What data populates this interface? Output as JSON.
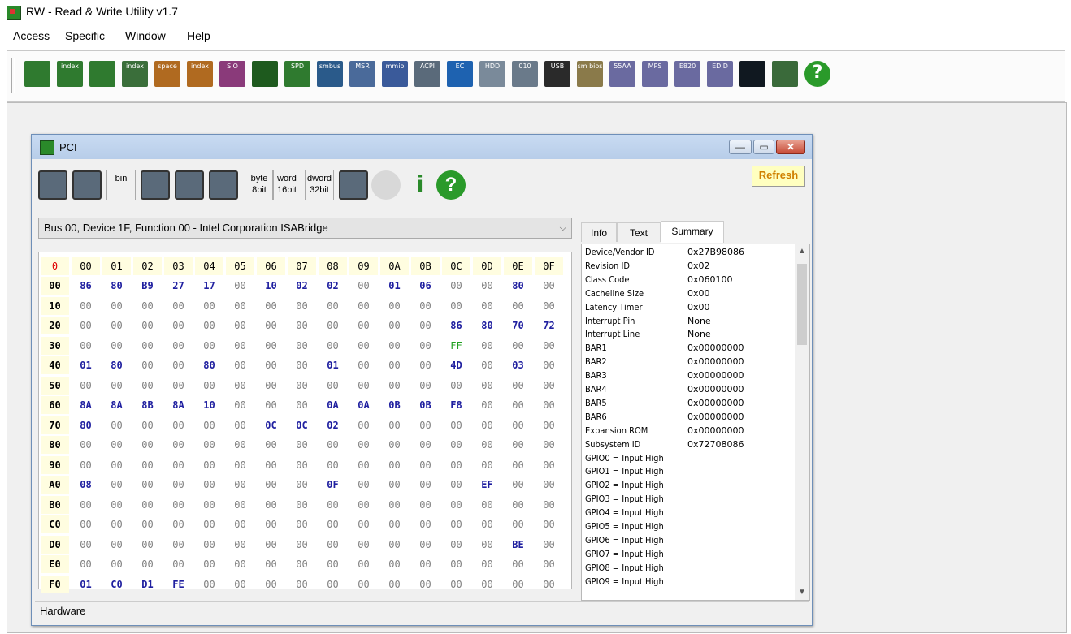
{
  "app": {
    "title": "RW - Read & Write Utility v1.7"
  },
  "menu": [
    "Access",
    "Specific",
    "Window",
    "Help"
  ],
  "toolbar": [
    {
      "name": "memory-icon",
      "label": "",
      "color": "#2f7a2f"
    },
    {
      "name": "memory-index-icon",
      "label": "index",
      "color": "#2f7a2f"
    },
    {
      "name": "ram-icon",
      "label": "",
      "color": "#2f7a2f"
    },
    {
      "name": "ram-index-icon",
      "label": "index",
      "color": "#3a6e3a"
    },
    {
      "name": "io-space-icon",
      "label": "space",
      "color": "#b06a20"
    },
    {
      "name": "io-index-icon",
      "label": "index",
      "color": "#b06a20"
    },
    {
      "name": "sio-icon",
      "label": "SIO",
      "color": "#8a3a7a"
    },
    {
      "name": "scope-icon",
      "label": "",
      "color": "#1e5a1e"
    },
    {
      "name": "spd-icon",
      "label": "SPD",
      "color": "#2f7a2f"
    },
    {
      "name": "smbus-icon",
      "label": "smbus",
      "color": "#2a5a8a"
    },
    {
      "name": "msr-icon",
      "label": "MSR",
      "color": "#4a6a9a"
    },
    {
      "name": "mmio-icon",
      "label": "mmio",
      "color": "#3a5a9a"
    },
    {
      "name": "acpi-icon",
      "label": "ACPI",
      "color": "#5a6a7a"
    },
    {
      "name": "ec-icon",
      "label": "EC",
      "color": "#1e62b0"
    },
    {
      "name": "hdd-icon",
      "label": "HDD",
      "color": "#7a8a9a"
    },
    {
      "name": "disk-icon",
      "label": "010",
      "color": "#6a7a8a"
    },
    {
      "name": "usb-icon",
      "label": "USB",
      "color": "#2a2a2a"
    },
    {
      "name": "smbios-icon",
      "label": "sm bios",
      "color": "#8a7a4a"
    },
    {
      "name": "55aa-icon",
      "label": "55AA",
      "color": "#6a6aa0"
    },
    {
      "name": "mps-icon",
      "label": "MPS",
      "color": "#6a6aa0"
    },
    {
      "name": "e820-icon",
      "label": "E820",
      "color": "#6a6aa0"
    },
    {
      "name": "edid-icon",
      "label": "EDID",
      "color": "#6a6aa0"
    },
    {
      "name": "command-icon",
      "label": "",
      "color": "#101820"
    },
    {
      "name": "battery-icon",
      "label": "",
      "color": "#3a6a3a"
    },
    {
      "name": "help-icon",
      "label": "?",
      "color": "#2a9a2a"
    }
  ],
  "pci": {
    "title": "PCI",
    "tools": [
      {
        "name": "save-icon",
        "label": ""
      },
      {
        "name": "save-all-icon",
        "label": ""
      },
      {
        "name": "save-bin-icon",
        "label": "bin"
      },
      {
        "name": "open-icon",
        "label": ""
      },
      {
        "name": "find-icon",
        "label": ""
      },
      {
        "name": "table-icon",
        "label": ""
      },
      {
        "name": "byte-8bit-icon",
        "label": "byte 8bit"
      },
      {
        "name": "word-16bit-icon",
        "label": "word 16bit"
      },
      {
        "name": "dword-32bit-icon",
        "label": "dword 32bit"
      },
      {
        "name": "tree-icon",
        "label": ""
      },
      {
        "name": "disabled-icon",
        "label": ""
      },
      {
        "name": "info-icon",
        "label": "i"
      },
      {
        "name": "help-icon",
        "label": "?"
      }
    ],
    "refresh_label": "Refresh",
    "device": "Bus 00, Device 1F, Function 00 - Intel Corporation ISABridge",
    "status": "Hardware",
    "tabs": [
      "Info",
      "Text",
      "Summary"
    ],
    "columns": [
      "0",
      "00",
      "01",
      "02",
      "03",
      "04",
      "05",
      "06",
      "07",
      "08",
      "09",
      "0A",
      "0B",
      "0C",
      "0D",
      "0E",
      "0F"
    ],
    "rows": [
      {
        "h": "00",
        "v": [
          "86",
          "80",
          "B9",
          "27",
          "17",
          "00",
          "10",
          "02",
          "02",
          "00",
          "01",
          "06",
          "00",
          "00",
          "80",
          "00"
        ]
      },
      {
        "h": "10",
        "v": [
          "00",
          "00",
          "00",
          "00",
          "00",
          "00",
          "00",
          "00",
          "00",
          "00",
          "00",
          "00",
          "00",
          "00",
          "00",
          "00"
        ]
      },
      {
        "h": "20",
        "v": [
          "00",
          "00",
          "00",
          "00",
          "00",
          "00",
          "00",
          "00",
          "00",
          "00",
          "00",
          "00",
          "86",
          "80",
          "70",
          "72"
        ]
      },
      {
        "h": "30",
        "v": [
          "00",
          "00",
          "00",
          "00",
          "00",
          "00",
          "00",
          "00",
          "00",
          "00",
          "00",
          "00",
          "FF",
          "00",
          "00",
          "00"
        ]
      },
      {
        "h": "40",
        "v": [
          "01",
          "80",
          "00",
          "00",
          "80",
          "00",
          "00",
          "00",
          "01",
          "00",
          "00",
          "00",
          "4D",
          "00",
          "03",
          "00"
        ]
      },
      {
        "h": "50",
        "v": [
          "00",
          "00",
          "00",
          "00",
          "00",
          "00",
          "00",
          "00",
          "00",
          "00",
          "00",
          "00",
          "00",
          "00",
          "00",
          "00"
        ]
      },
      {
        "h": "60",
        "v": [
          "8A",
          "8A",
          "8B",
          "8A",
          "10",
          "00",
          "00",
          "00",
          "0A",
          "0A",
          "0B",
          "0B",
          "F8",
          "00",
          "00",
          "00"
        ]
      },
      {
        "h": "70",
        "v": [
          "80",
          "00",
          "00",
          "00",
          "00",
          "00",
          "0C",
          "0C",
          "02",
          "00",
          "00",
          "00",
          "00",
          "00",
          "00",
          "00"
        ]
      },
      {
        "h": "80",
        "v": [
          "00",
          "00",
          "00",
          "00",
          "00",
          "00",
          "00",
          "00",
          "00",
          "00",
          "00",
          "00",
          "00",
          "00",
          "00",
          "00"
        ]
      },
      {
        "h": "90",
        "v": [
          "00",
          "00",
          "00",
          "00",
          "00",
          "00",
          "00",
          "00",
          "00",
          "00",
          "00",
          "00",
          "00",
          "00",
          "00",
          "00"
        ]
      },
      {
        "h": "A0",
        "v": [
          "08",
          "00",
          "00",
          "00",
          "00",
          "00",
          "00",
          "00",
          "0F",
          "00",
          "00",
          "00",
          "00",
          "EF",
          "00",
          "00"
        ]
      },
      {
        "h": "B0",
        "v": [
          "00",
          "00",
          "00",
          "00",
          "00",
          "00",
          "00",
          "00",
          "00",
          "00",
          "00",
          "00",
          "00",
          "00",
          "00",
          "00"
        ]
      },
      {
        "h": "C0",
        "v": [
          "00",
          "00",
          "00",
          "00",
          "00",
          "00",
          "00",
          "00",
          "00",
          "00",
          "00",
          "00",
          "00",
          "00",
          "00",
          "00"
        ]
      },
      {
        "h": "D0",
        "v": [
          "00",
          "00",
          "00",
          "00",
          "00",
          "00",
          "00",
          "00",
          "00",
          "00",
          "00",
          "00",
          "00",
          "00",
          "BE",
          "00"
        ]
      },
      {
        "h": "E0",
        "v": [
          "00",
          "00",
          "00",
          "00",
          "00",
          "00",
          "00",
          "00",
          "00",
          "00",
          "00",
          "00",
          "00",
          "00",
          "00",
          "00"
        ]
      },
      {
        "h": "F0",
        "v": [
          "01",
          "C0",
          "D1",
          "FE",
          "00",
          "00",
          "00",
          "00",
          "00",
          "00",
          "00",
          "00",
          "00",
          "00",
          "00",
          "00"
        ]
      }
    ],
    "summary": [
      [
        "Device/Vendor ID",
        "0x27B98086"
      ],
      [
        "Revision ID",
        "0x02"
      ],
      [
        "Class Code",
        "0x060100"
      ],
      [
        "Cacheline Size",
        "0x00"
      ],
      [
        "Latency Timer",
        "0x00"
      ],
      [
        "Interrupt Pin",
        "None"
      ],
      [
        "Interrupt Line",
        "None"
      ],
      [
        "BAR1",
        "0x00000000"
      ],
      [
        "BAR2",
        "0x00000000"
      ],
      [
        "BAR3",
        "0x00000000"
      ],
      [
        "BAR4",
        "0x00000000"
      ],
      [
        "BAR5",
        "0x00000000"
      ],
      [
        "BAR6",
        "0x00000000"
      ],
      [
        "Expansion ROM",
        "0x00000000"
      ],
      [
        "Subsystem ID",
        "0x72708086"
      ],
      [
        "GPIO0 = Input High",
        ""
      ],
      [
        "GPIO1 = Input High",
        ""
      ],
      [
        "GPIO2 = Input High",
        ""
      ],
      [
        "GPIO3 = Input High",
        ""
      ],
      [
        "GPIO4 = Input High",
        ""
      ],
      [
        "GPIO5 = Input High",
        ""
      ],
      [
        "GPIO6 = Input High",
        ""
      ],
      [
        "GPIO7 = Input High",
        ""
      ],
      [
        "GPIO8 = Input High",
        ""
      ],
      [
        "GPIO9 = Input High",
        ""
      ]
    ]
  }
}
